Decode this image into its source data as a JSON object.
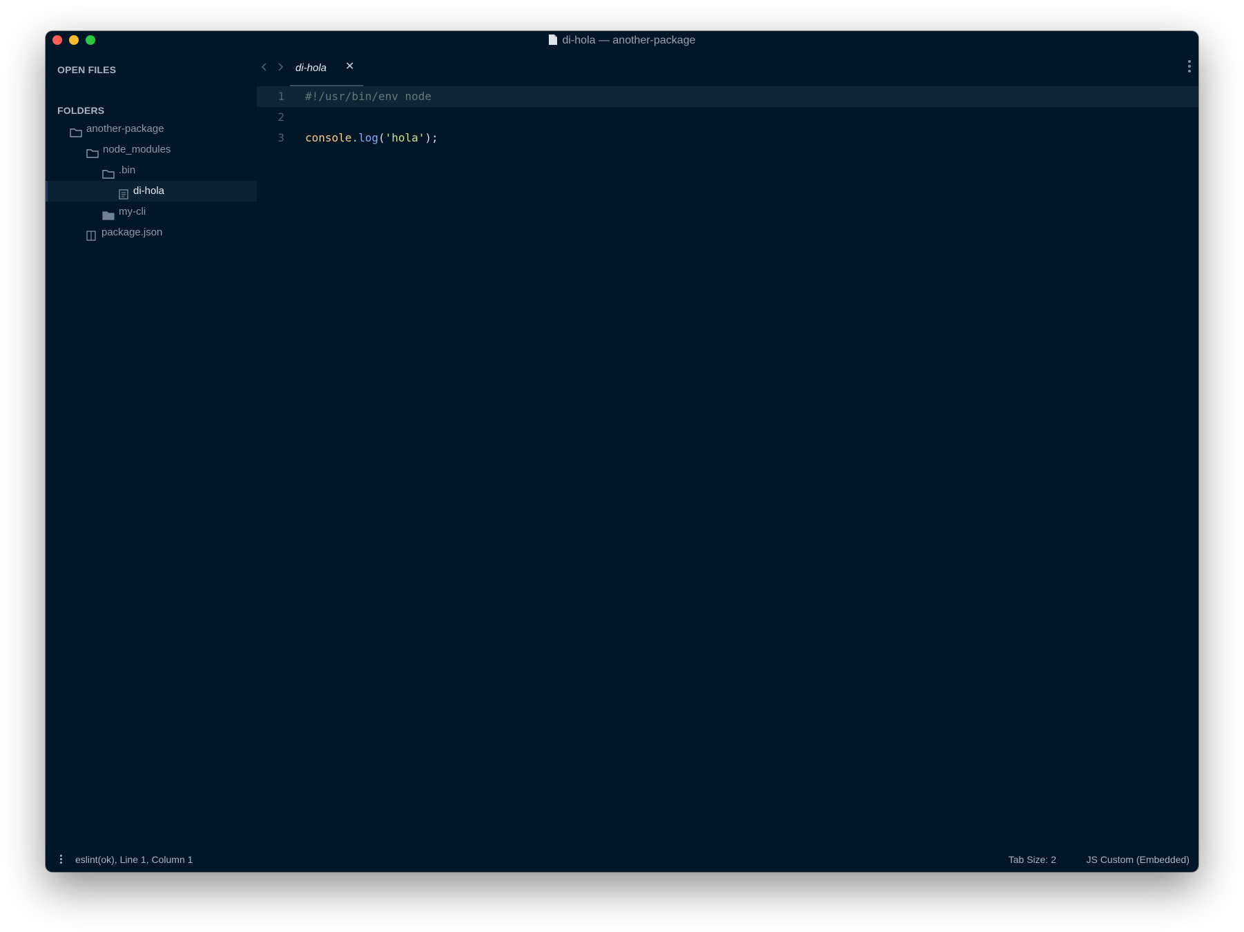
{
  "window": {
    "title": "di-hola — another-package"
  },
  "sidebar": {
    "open_files_heading": "OPEN FILES",
    "folders_heading": "FOLDERS",
    "tree": [
      {
        "label": "another-package",
        "icon": "folder-open-icon"
      },
      {
        "label": "node_modules",
        "icon": "folder-open-icon"
      },
      {
        "label": ".bin",
        "icon": "folder-open-icon"
      },
      {
        "label": "di-hola",
        "icon": "file-icon",
        "selected": true
      },
      {
        "label": "my-cli",
        "icon": "folder-closed-icon"
      },
      {
        "label": "package.json",
        "icon": "file-icon"
      }
    ]
  },
  "tabs": [
    {
      "label": "di-hola",
      "active": true,
      "close": "✕"
    }
  ],
  "editor": {
    "lines": [
      {
        "number": "1",
        "text": "#!/usr/bin/env node"
      },
      {
        "number": "2",
        "text": ""
      },
      {
        "number": "3",
        "text": "console.log('hola');"
      }
    ]
  },
  "statusbar": {
    "left": "eslint(ok), Line 1, Column 1",
    "tab_size": "Tab Size: 2",
    "syntax": "JS Custom (Embedded)"
  },
  "colors": {
    "background": "#011627",
    "current_line": "#0f2536",
    "selected_item": "#0c2233",
    "traffic_close": "#fe5f57",
    "traffic_minimize": "#febc2e",
    "traffic_zoom": "#28c840"
  }
}
